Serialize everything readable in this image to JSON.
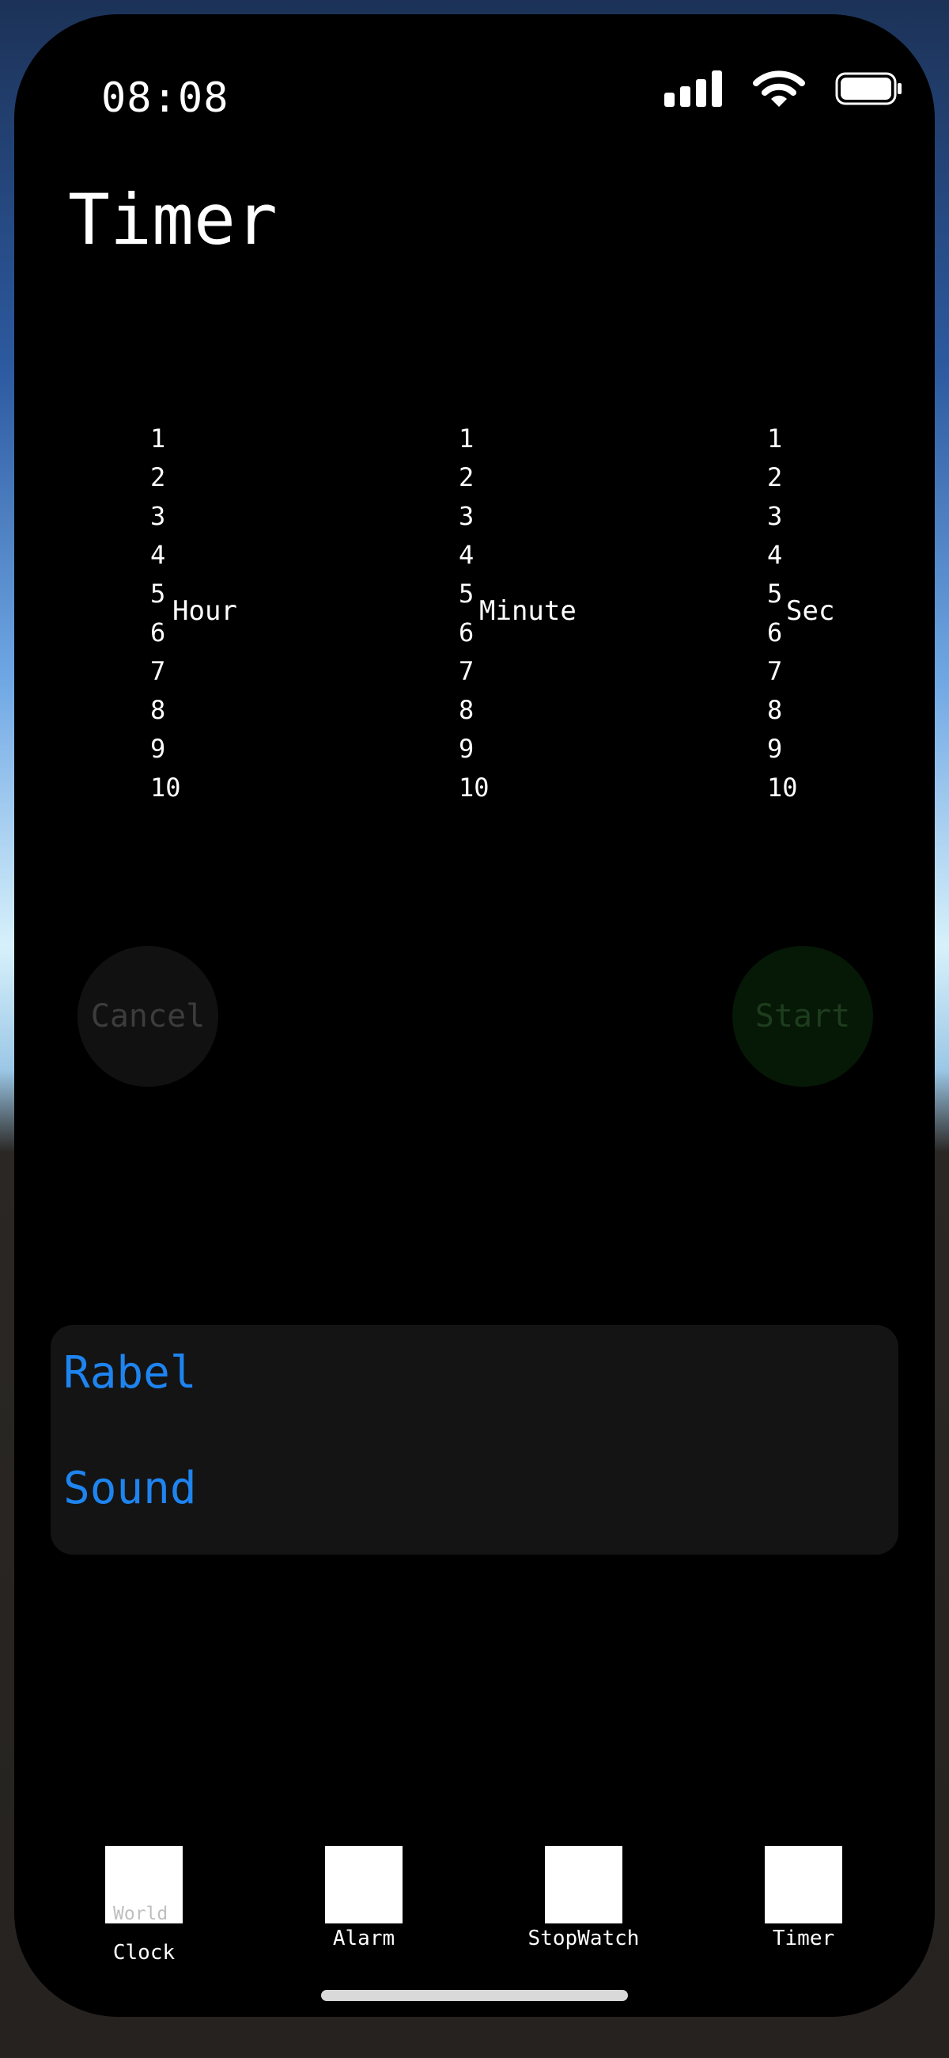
{
  "status_bar": {
    "time": "08:08",
    "signal_icon": "cellular-signal-icon",
    "wifi_icon": "wifi-icon",
    "battery_icon": "battery-icon"
  },
  "page": {
    "title": "Timer"
  },
  "picker": {
    "hour": {
      "values": [
        "1",
        "2",
        "3",
        "4",
        "5",
        "6",
        "7",
        "8",
        "9",
        "10"
      ],
      "unit": "Hour"
    },
    "minute": {
      "values": [
        "1",
        "2",
        "3",
        "4",
        "5",
        "6",
        "7",
        "8",
        "9",
        "10"
      ],
      "unit": "Minute"
    },
    "second": {
      "values": [
        "1",
        "2",
        "3",
        "4",
        "5",
        "6",
        "7",
        "8",
        "9",
        "10"
      ],
      "unit": "Sec"
    }
  },
  "controls": {
    "cancel_label": "Cancel",
    "start_label": "Start"
  },
  "options": {
    "label_row": "Rabel",
    "sound_row": "Sound"
  },
  "tabbar": {
    "items": [
      {
        "icon_text": "World",
        "label": "Clock",
        "icon": "world-clock-tab-icon"
      },
      {
        "label": "Alarm",
        "icon": "alarm-tab-icon"
      },
      {
        "label": "StopWatch",
        "icon": "stopwatch-tab-icon"
      },
      {
        "label": "Timer",
        "icon": "timer-tab-icon"
      }
    ]
  },
  "colors": {
    "accent_blue": "#1e84f0",
    "start_bg": "#061806",
    "cancel_bg": "#111111"
  }
}
